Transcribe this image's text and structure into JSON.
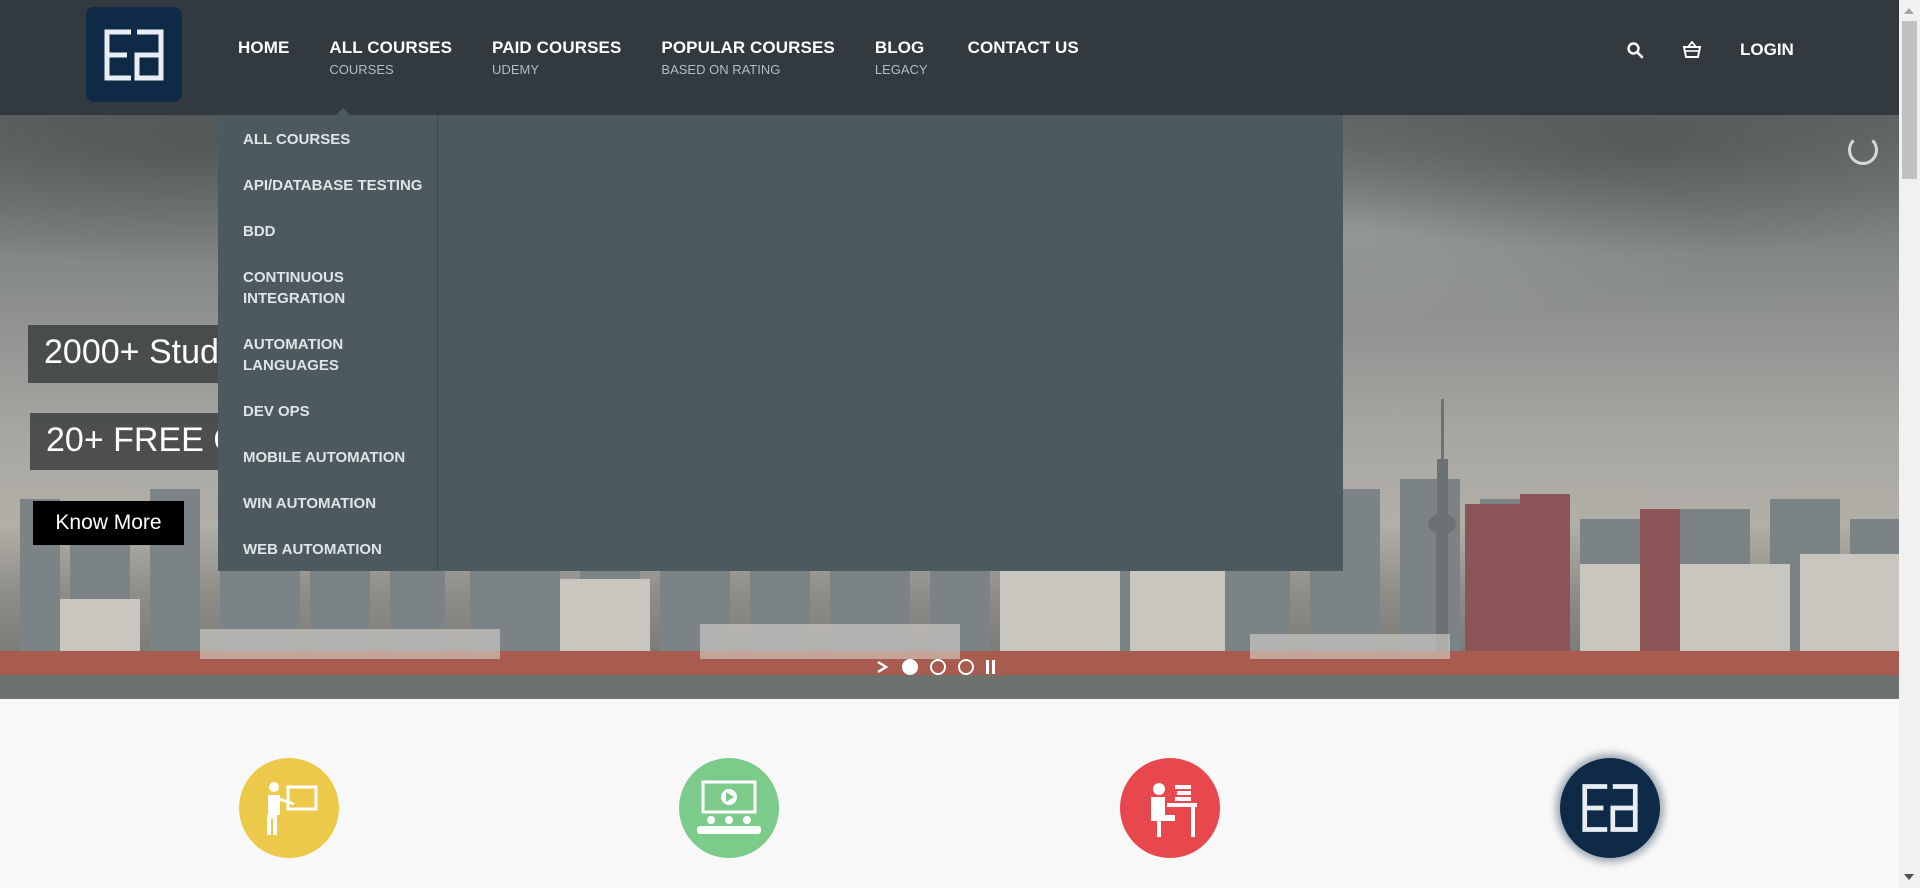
{
  "header": {
    "nav": [
      {
        "label": "HOME",
        "sub": ""
      },
      {
        "label": "ALL COURSES",
        "sub": "COURSES"
      },
      {
        "label": "PAID COURSES",
        "sub": "UDEMY"
      },
      {
        "label": "POPULAR COURSES",
        "sub": "BASED ON RATING"
      },
      {
        "label": "BLOG",
        "sub": "LEGACY"
      },
      {
        "label": "CONTACT US",
        "sub": ""
      }
    ],
    "login": "LOGIN",
    "icons": [
      "search-icon",
      "cart-icon"
    ]
  },
  "dropdown": {
    "items": [
      "ALL COURSES",
      "API/DATABASE TESTING",
      "BDD",
      "CONTINUOUS INTEGRATION",
      "AUTOMATION LANGUAGES",
      "DEV OPS",
      "MOBILE AUTOMATION",
      "WIN AUTOMATION",
      "WEB AUTOMATION"
    ]
  },
  "hero": {
    "line1": "2000+ Stud",
    "line2": "20+ FREE C",
    "cta": "Know More",
    "slides": 3,
    "active_slide": 1
  },
  "features": [
    {
      "icon": "teacher-icon",
      "color": "#ecc94b"
    },
    {
      "icon": "video-class-icon",
      "color": "#7dcb8b"
    },
    {
      "icon": "student-desk-icon",
      "color": "#e8474d"
    },
    {
      "icon": "ea-logo-icon",
      "color": "#0e2a47"
    }
  ],
  "colors": {
    "header_bg": "#323a3f",
    "dropdown_bg": "#4c595e",
    "logo_bg": "#0e2a47"
  }
}
